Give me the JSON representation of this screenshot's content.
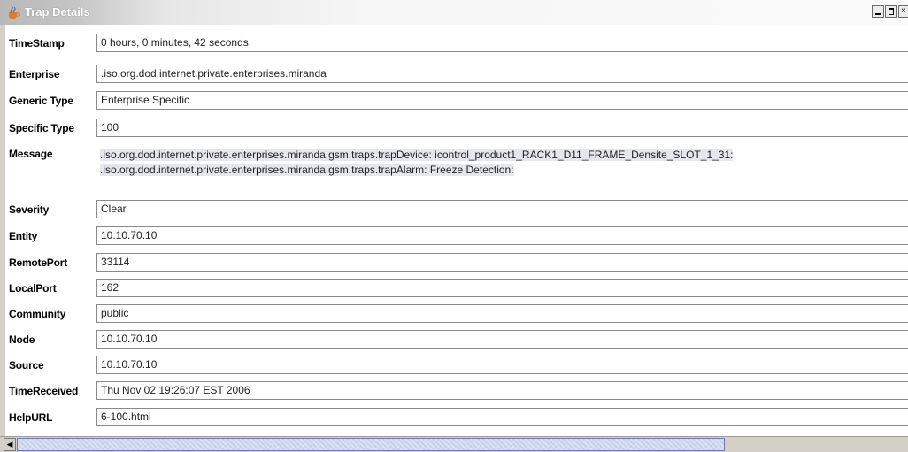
{
  "window": {
    "title": "Trap Details",
    "icon": "java-cup-icon",
    "controls": [
      "minimize-icon",
      "maximize-icon",
      "close-icon"
    ]
  },
  "fields": {
    "timestamp": {
      "label": "TimeStamp",
      "value": "0 hours, 0 minutes, 42 seconds."
    },
    "enterprise": {
      "label": "Enterprise",
      "value": ".iso.org.dod.internet.private.enterprises.miranda"
    },
    "generic_type": {
      "label": "Generic Type",
      "value": "Enterprise Specific"
    },
    "specific_type": {
      "label": "Specific Type",
      "value": "100"
    },
    "message": {
      "label": "Message",
      "lines": [
        ".iso.org.dod.internet.private.enterprises.miranda.gsm.traps.trapDevice:  icontrol_product1_RACK1_D11_FRAME_Densite_SLOT_1_31:",
        ".iso.org.dod.internet.private.enterprises.miranda.gsm.traps.trapAlarm:  Freeze Detection:"
      ]
    },
    "severity": {
      "label": "Severity",
      "value": "Clear"
    },
    "entity": {
      "label": "Entity",
      "value": "10.10.70.10"
    },
    "remote_port": {
      "label": "RemotePort",
      "value": "33114"
    },
    "local_port": {
      "label": "LocalPort",
      "value": "162"
    },
    "community": {
      "label": "Community",
      "value": "public"
    },
    "node": {
      "label": "Node",
      "value": "10.10.70.10"
    },
    "source": {
      "label": "Source",
      "value": "10.10.70.10"
    },
    "time_received": {
      "label": "TimeReceived",
      "value": "Thu Nov 02 19:26:07 EST 2006"
    },
    "help_url": {
      "label": "HelpURL",
      "value": "6-100.html"
    }
  },
  "scrollbar": {
    "position": 0.0,
    "left_arrow_icon": "left-arrow-icon"
  },
  "colors": {
    "titlebar_fade": "#b8b8b8",
    "scroll_thumb": "#c9d1ea",
    "message_highlight": "#e6e6ee"
  }
}
